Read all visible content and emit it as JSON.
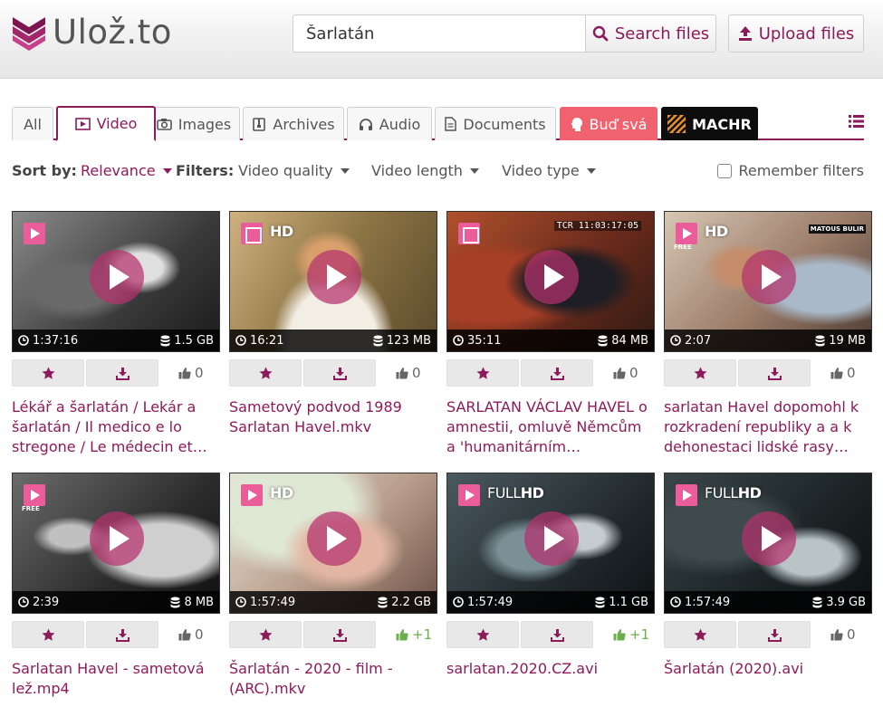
{
  "header": {
    "logo_text": "Ulož.to",
    "search_value": "Šarlatán",
    "search_button": "Search files",
    "upload_button": "Upload files"
  },
  "tabs": [
    {
      "label": "All"
    },
    {
      "label": "Video"
    },
    {
      "label": "Images"
    },
    {
      "label": "Archives"
    },
    {
      "label": "Audio"
    },
    {
      "label": "Documents"
    },
    {
      "label": "Buď svá"
    },
    {
      "label": "MACHR"
    }
  ],
  "filters": {
    "sort_label": "Sort by:",
    "sort_value": "Relevance",
    "filters_label": "Filters:",
    "video_quality": "Video quality",
    "video_length": "Video length",
    "video_type": "Video type",
    "remember": "Remember filters"
  },
  "colors": {
    "accent": "#8b1b5b",
    "pink": "#ea5d9a",
    "promo": "#f0626e"
  },
  "cards": [
    {
      "duration": "1:37:16",
      "size": "1.5 GB",
      "likes": "0",
      "quality": "",
      "icon": "play",
      "free": false,
      "title": "Lékář a šarlatán / Lekár a šarlatán / Il medico e lo stregone / Le médecin et le…"
    },
    {
      "duration": "16:21",
      "size": "123 MB",
      "likes": "0",
      "quality": "HD",
      "icon": "film",
      "free": false,
      "title": "Sametový podvod 1989 Sarlatan Havel.mkv"
    },
    {
      "duration": "35:11",
      "size": "84 MB",
      "likes": "0",
      "quality": "",
      "icon": "film",
      "free": false,
      "title": "SARLATAN VÁCLAV HAVEL o amnestii, omluvě Němcům a 'humanitárním…"
    },
    {
      "duration": "2:07",
      "size": "19 MB",
      "likes": "0",
      "quality": "HD",
      "icon": "play",
      "free": true,
      "title": "sarlatan Havel dopomohl k rozkradení republiky a a k dehonestaci lidské rasy jako…"
    },
    {
      "duration": "2:39",
      "size": "8 MB",
      "likes": "0",
      "quality": "",
      "icon": "play",
      "free": true,
      "title": "Sarlatan Havel - sametová lež.mp4"
    },
    {
      "duration": "1:57:49",
      "size": "2.2 GB",
      "likes": "+1",
      "quality": "HD",
      "icon": "play",
      "free": false,
      "title": "Šarlatán - 2020 - film - (ARC).mkv"
    },
    {
      "duration": "1:57:49",
      "size": "1.1 GB",
      "likes": "+1",
      "quality": "FULLHD",
      "icon": "play",
      "free": false,
      "title": "sarlatan.2020.CZ.avi"
    },
    {
      "duration": "1:57:49",
      "size": "3.9 GB",
      "likes": "0",
      "quality": "FULLHD",
      "icon": "play",
      "free": false,
      "title": "Šarlatán (2020).avi"
    }
  ],
  "thumb_overlays": {
    "tcr": "TCR 11:03:17:05",
    "watermark": "MATOUS BULIR",
    "free": "FREE"
  }
}
